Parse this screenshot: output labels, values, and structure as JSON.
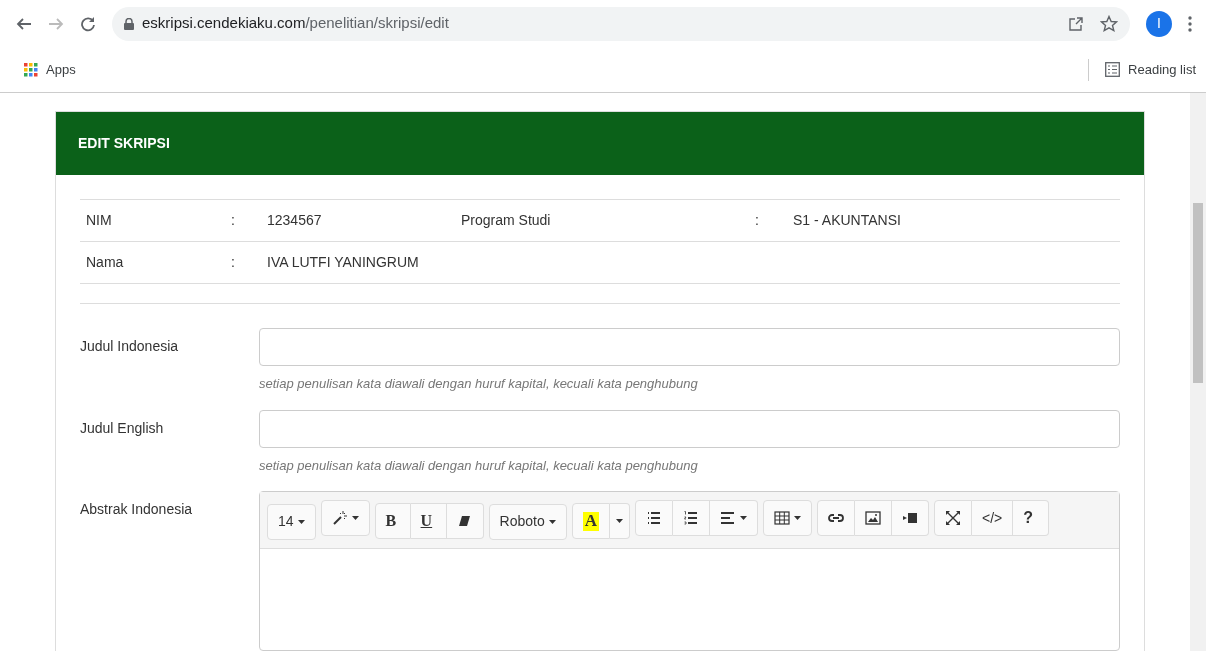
{
  "browser": {
    "url_host": "eskripsi.cendekiaku.com",
    "url_path": "/penelitian/skripsi/edit",
    "avatar": "I",
    "bookmarks": [
      {
        "label": "Apps",
        "kind": "apps"
      }
    ],
    "reading_list": "Reading list"
  },
  "card": {
    "title": "EDIT SKRIPSI",
    "info_rows": [
      {
        "label": "NIM",
        "sep": ":",
        "value": "1234567",
        "label2": "Program Studi",
        "sep2": ":",
        "value2": "S1 - AKUNTANSI"
      },
      {
        "label": "Nama",
        "sep": ":",
        "value": "IVA LUTFI YANINGRUM"
      }
    ],
    "fields": [
      {
        "label": "Judul Indonesia",
        "kind": "input",
        "help": "setiap penulisan kata diawali dengan huruf kapital, kecuali kata penghubung"
      },
      {
        "label": "Judul English",
        "kind": "input",
        "help": "setiap penulisan kata diawali dengan huruf kapital, kecuali kata penghubung"
      },
      {
        "label": "Abstrak Indonesia",
        "kind": "editor"
      }
    ],
    "toolbar": [
      [
        {
          "kind": "dropdown",
          "label": "14"
        }
      ],
      [
        {
          "kind": "icondropdown"
        }
      ],
      [
        {
          "kind": "bold",
          "label": "B"
        },
        {
          "kind": "underline",
          "label": "U"
        },
        {
          "kind": "icon"
        }
      ],
      [
        {
          "kind": "dropdown",
          "label": "Roboto"
        }
      ],
      [
        {
          "kind": "highlight",
          "label": "A"
        },
        {
          "kind": "caret"
        }
      ],
      [
        {
          "kind": "icon"
        },
        {
          "kind": "icon"
        },
        {
          "kind": "icondropdown"
        }
      ],
      [
        {
          "kind": "icondropdown"
        }
      ],
      [
        {
          "kind": "icon"
        },
        {
          "kind": "icon"
        },
        {
          "kind": "icon"
        }
      ],
      [
        {
          "kind": "icon"
        },
        {
          "kind": "plain",
          "label": "</>"
        },
        {
          "kind": "strong",
          "label": "?"
        }
      ]
    ]
  }
}
